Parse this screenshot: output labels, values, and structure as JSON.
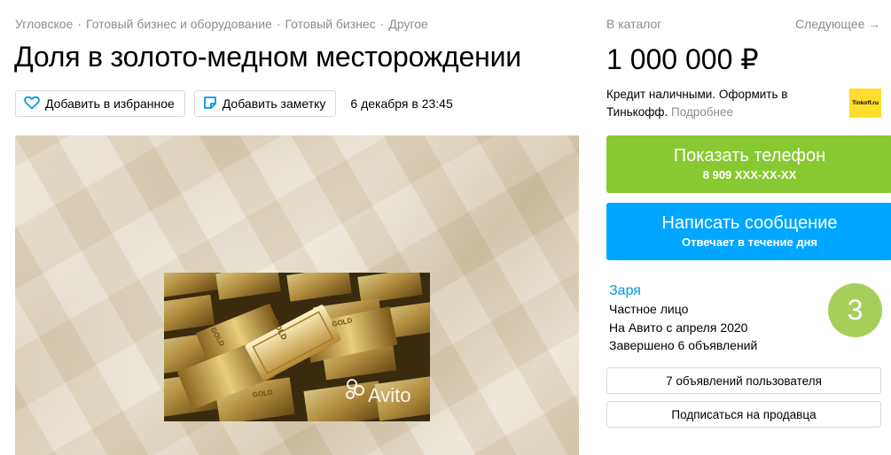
{
  "breadcrumb": {
    "items": [
      "Угловское",
      "Готовый бизнес и оборудование",
      "Готовый бизнес",
      "Другое"
    ],
    "separator": "·"
  },
  "title": "Доля в золото-медном месторождении",
  "actions": {
    "favorite_label": "Добавить в избранное",
    "note_label": "Добавить заметку",
    "date": "6 декабря в 23:45"
  },
  "gallery": {
    "watermark": "Avito",
    "bar_labels": [
      "GOLD",
      "GOLD",
      "GOLD",
      "GOLD"
    ]
  },
  "nav": {
    "catalog": "В каталог",
    "next": "Следующее →"
  },
  "price": "1 000 000 ₽",
  "credit": {
    "text": "Кредит наличными. Оформить в Тинькофф.",
    "more": "Подробнее",
    "logo_text": "Tinkoff.ru"
  },
  "phone_button": {
    "label": "Показать телефон",
    "number": "8 909 XXX-XX-XX"
  },
  "message_button": {
    "label": "Написать сообщение",
    "sub": "Отвечает в течение дня"
  },
  "seller": {
    "name": "Заря",
    "type": "Частное лицо",
    "since": "На Авито с апреля 2020",
    "completed": "Завершено 6 объявлений",
    "rating": "3"
  },
  "seller_buttons": {
    "listings": "7 объявлений пользователя",
    "subscribe": "Подписаться на продавца"
  },
  "colors": {
    "green": "#88c932",
    "blue": "#00a6ff",
    "link": "#0099e6",
    "muted": "#8c8c8c",
    "avatar": "#a5cf5b",
    "tinkoff": "#ffdd2d"
  }
}
